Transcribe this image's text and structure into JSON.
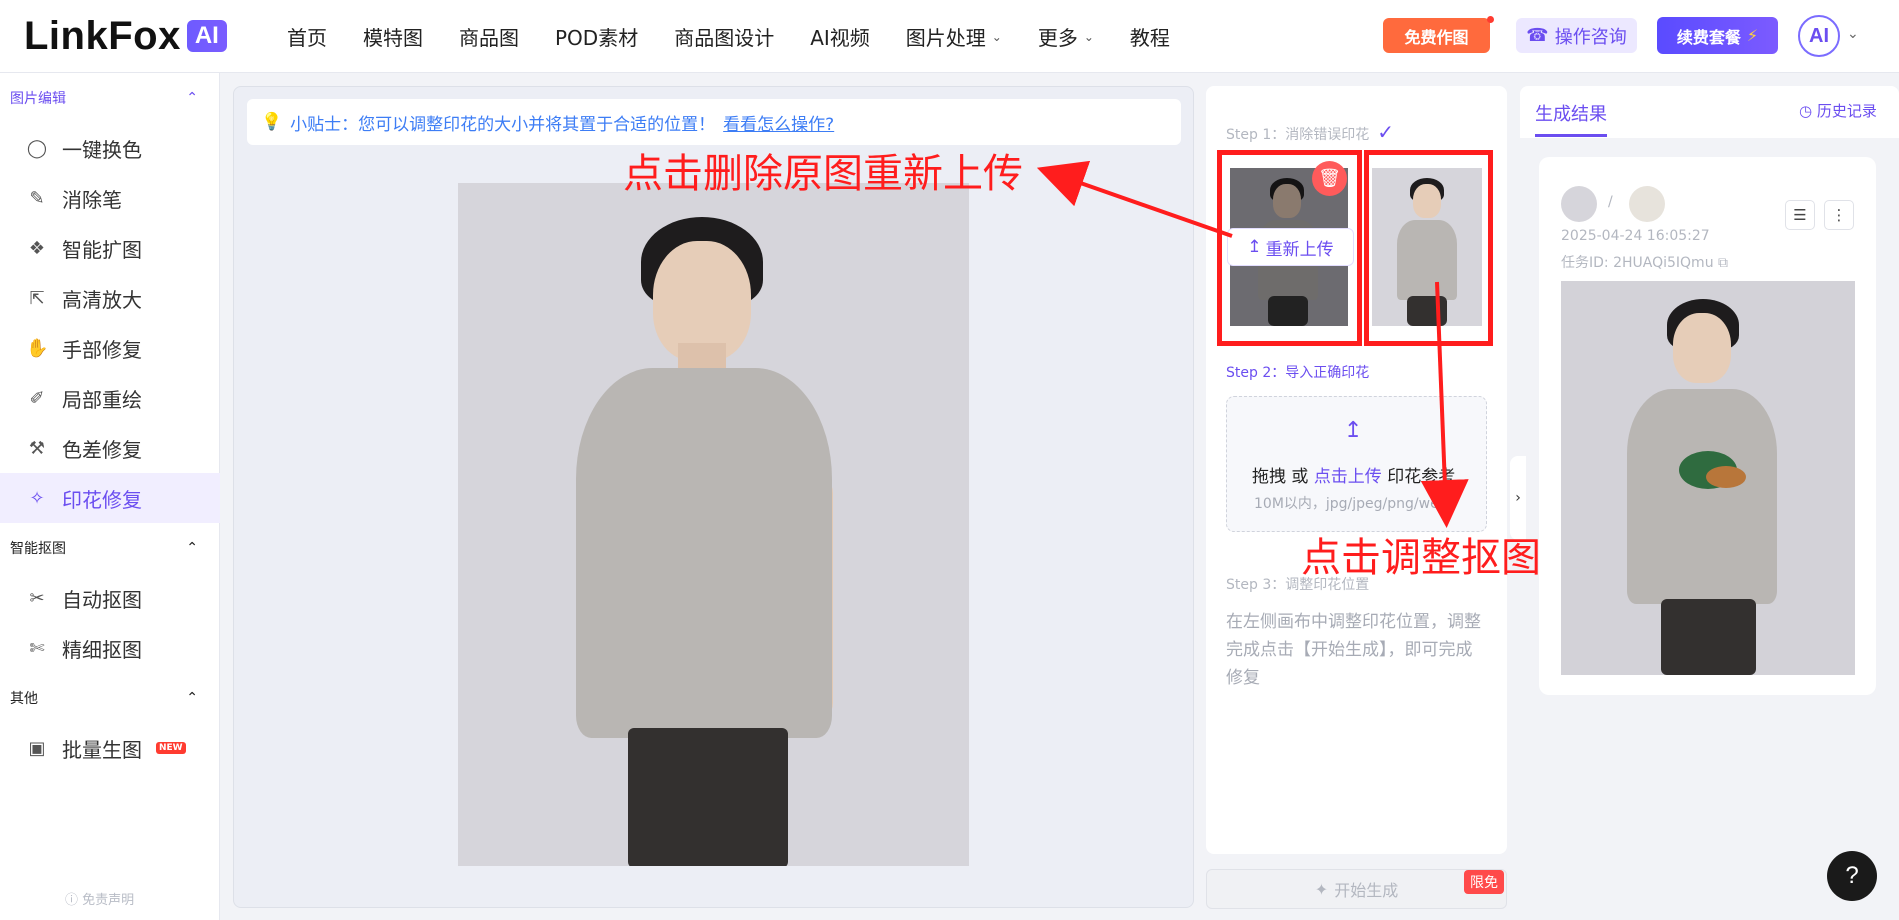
{
  "header": {
    "logo_text": "LinkFox",
    "logo_badge": "AI",
    "nav": [
      {
        "label": "首页"
      },
      {
        "label": "模特图"
      },
      {
        "label": "商品图"
      },
      {
        "label": "POD素材"
      },
      {
        "label": "商品图设计"
      },
      {
        "label": "AI视频"
      },
      {
        "label": "图片处理",
        "dropdown": true
      },
      {
        "label": "更多",
        "dropdown": true
      },
      {
        "label": "教程"
      }
    ],
    "free_btn": "免费作图",
    "consult_btn": "操作咨询",
    "renew_btn": "续费套餐",
    "avatar_text": "AI"
  },
  "sidebar": {
    "sections": [
      {
        "title": "图片编辑",
        "items": [
          {
            "label": "一键换色",
            "icon": "palette-icon"
          },
          {
            "label": "消除笔",
            "icon": "eraser-icon"
          },
          {
            "label": "智能扩图",
            "icon": "expand-icon"
          },
          {
            "label": "高清放大",
            "icon": "upscale-icon"
          },
          {
            "label": "手部修复",
            "icon": "hand-icon"
          },
          {
            "label": "局部重绘",
            "icon": "brush-icon"
          },
          {
            "label": "色差修复",
            "icon": "color-fix-icon"
          },
          {
            "label": "印花修复",
            "icon": "sparkle-icon",
            "active": true
          }
        ]
      },
      {
        "title": "智能抠图",
        "items": [
          {
            "label": "自动抠图",
            "icon": "auto-cutout-icon"
          },
          {
            "label": "精细抠图",
            "icon": "fine-cutout-icon"
          }
        ]
      },
      {
        "title": "其他",
        "items": [
          {
            "label": "批量生图",
            "icon": "image-icon",
            "badge": "NEW"
          }
        ]
      }
    ],
    "disclaimer": "免责声明"
  },
  "canvas": {
    "tip_prefix": "小贴士：您可以调整印花的大小并将其置于合适的位置！",
    "tip_link": "看看怎么操作?"
  },
  "steps": {
    "step1": "Step 1：消除错误印花",
    "reupload": "重新上传",
    "step2": "Step 2：导入正确印花",
    "upload_drag": "拖拽 或 ",
    "upload_link": "点击上传",
    "upload_suffix": " 印花参考",
    "upload_hint": "10M以内，jpg/jpeg/png/webp",
    "step3": "Step 3：调整印花位置",
    "step3_desc": "在左侧画布中调整印花位置，调整完成点击【开始生成】，即可完成修复",
    "generate": "开始生成",
    "limit_badge": "限免"
  },
  "result": {
    "tab": "生成结果",
    "history": "历史记录",
    "date": "2025-04-24 16:05:27",
    "task_id": "任务ID: 2HUAQi5IQmu"
  },
  "annotations": {
    "delete_note": "点击删除原图重新上传",
    "cutout_note": "点击调整抠图"
  },
  "colors": {
    "accent": "#6b4ef0",
    "annotation": "#ff1d1d"
  }
}
